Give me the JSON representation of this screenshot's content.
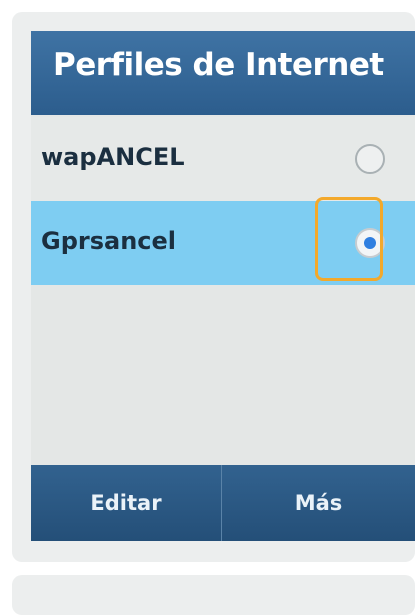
{
  "header": {
    "title": "Perfiles de Internet"
  },
  "profiles": [
    {
      "name": "wapANCEL",
      "selected": false
    },
    {
      "name": "Gprsancel",
      "selected": true
    }
  ],
  "softkeys": {
    "left": "Editar",
    "right": "Más"
  },
  "colors": {
    "header": "#3f73a4",
    "selected_row": "#7ecdf2",
    "radio_dot": "#2f7fe0",
    "highlight": "#f3a92b"
  }
}
